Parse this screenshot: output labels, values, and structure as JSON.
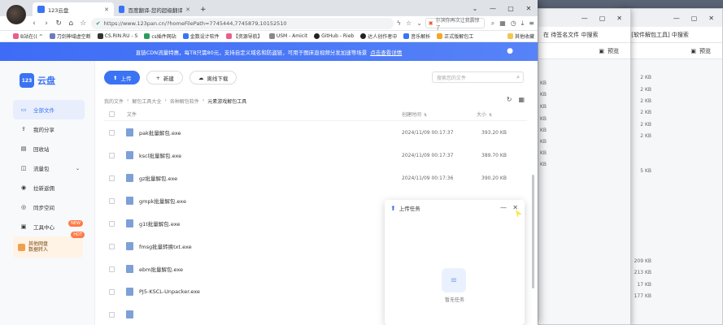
{
  "bg_windows": {
    "win1": {
      "toolbar_label": "在 待签名文件 中搜索",
      "preview": "预览"
    },
    "win2": {
      "toolbar_label": "在 [软件解包工具] 中搜索",
      "preview": "预览"
    },
    "sizes": [
      "KB",
      "KB",
      "KB",
      "KB",
      "KB",
      "KB",
      "KB",
      "KB",
      "209 KB",
      "213 KB",
      "17 KB",
      "177 KB",
      "2 KB",
      "2 KB",
      "2 KB",
      "2 KB",
      "2 KB",
      "2 KB",
      "5 KB"
    ]
  },
  "browser": {
    "tabs": [
      {
        "label": "123云盘",
        "favicon_color": "#3b73f5"
      },
      {
        "label": "百度翻译-您的超级翻译伙伴",
        "favicon_color": "#3b73f5"
      }
    ],
    "new_tab": "+",
    "url": {
      "host": "www.123pan.cn",
      "full": "https://www.123pan.cn/?homeFilePath=7745444,7745879,10152510"
    },
    "search_box": "尔滨你再次让我震惊了",
    "bookmarks": [
      {
        "label": "B站在(( ^ ",
        "color": "#e85f8b"
      },
      {
        "label": "刀剑神域虚空断",
        "color": "#6a7cbf"
      },
      {
        "label": "CS.RIN.RU - S",
        "color": "#333333"
      },
      {
        "label": "cs插件网站",
        "color": "#2a9d5c"
      },
      {
        "label": "金数设计软件",
        "color": "#3b73f5"
      },
      {
        "label": "【资源导航】",
        "color": "#e85f8b"
      },
      {
        "label": "USM - Amicit",
        "color": "#888888"
      },
      {
        "label": "GitHub - Rieb",
        "color": "#222222"
      },
      {
        "label": "达人创作者中",
        "color": "#222222"
      },
      {
        "label": "音乐解析",
        "color": "#3b73f5"
      },
      {
        "label": "正式版解包工",
        "color": "#f5a623"
      }
    ],
    "other_bookmarks": "其他收藏"
  },
  "banner": {
    "text": "直链CDN流量特惠，每TB只需80元，支持自定义域名和防盗链，可用于图床直视频分发加速等场景",
    "link": "点击查看详情"
  },
  "app": {
    "logo_badge": "123",
    "logo_name": "云盘",
    "nav": [
      {
        "label": "全部文件",
        "icon": "folder-icon"
      },
      {
        "label": "我的分享",
        "icon": "share-icon"
      },
      {
        "label": "回收站",
        "icon": "trash-icon"
      },
      {
        "label": "流量包",
        "icon": "traffic-icon"
      },
      {
        "label": "拉新返佣",
        "icon": "gift-icon"
      },
      {
        "label": "同步空间",
        "icon": "sync-icon"
      },
      {
        "label": "工具中心",
        "icon": "tools-icon",
        "tag": "NEW"
      }
    ],
    "promo": {
      "line1": "其他网盘",
      "line2": "数据转入",
      "tag": "HOT"
    },
    "actions": {
      "upload": "上传",
      "new": "新建",
      "offline": "离线下载"
    },
    "file_search_placeholder": "搜索您的文件",
    "breadcrumb": [
      "我的文件",
      "解包工具大全",
      "各种解包软件",
      "元素游戏解包工具"
    ],
    "table": {
      "col_name": "文件",
      "col_date": "创建时间",
      "col_size": "大小"
    },
    "rows": [
      {
        "name": "pak批量解包.exe",
        "date": "2024/11/09 00:17:37",
        "size": "393.20 KB"
      },
      {
        "name": "kscl批量解包.exe",
        "date": "2024/11/09 00:17:37",
        "size": "389.70 KB"
      },
      {
        "name": "gz批量解包.exe",
        "date": "2024/11/09 00:17:36",
        "size": "390.20 KB"
      },
      {
        "name": "gmpk批量解包.exe",
        "date": "",
        "size": ""
      },
      {
        "name": "g1t批量解包.exe",
        "date": "",
        "size": ""
      },
      {
        "name": "fmsg批量转换txt.exe",
        "date": "",
        "size": ""
      },
      {
        "name": "ebm批量解包.exe",
        "date": "",
        "size": ""
      },
      {
        "name": "PJ5-KSCL-Unpacker.exe",
        "date": "",
        "size": ""
      }
    ],
    "upload_panel": {
      "title": "上传任务",
      "empty_text": "暂无任务"
    }
  }
}
